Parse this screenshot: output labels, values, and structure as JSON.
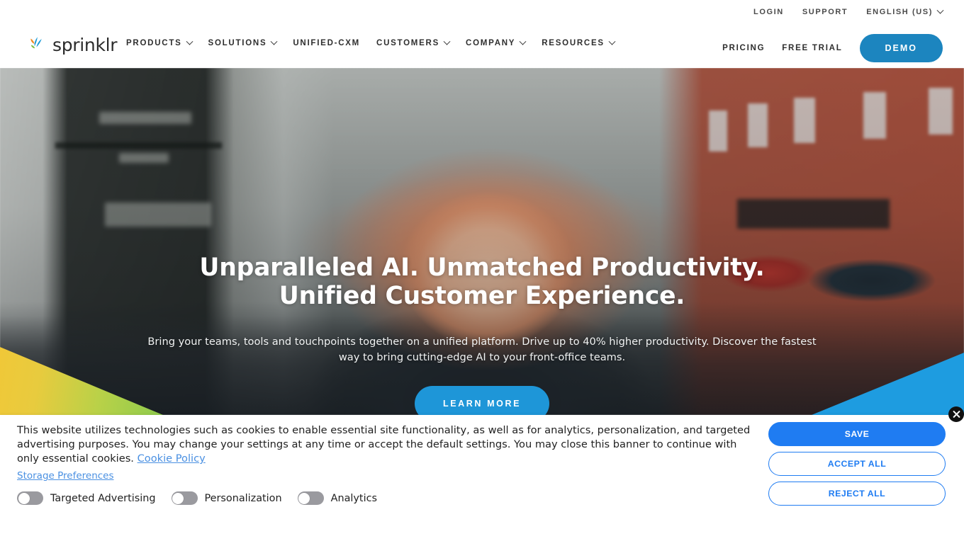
{
  "brand": {
    "name": "sprinklr",
    "logo_colors": [
      "#F08A24",
      "#1C9AD6",
      "#7DBE42"
    ]
  },
  "nav": {
    "utility": [
      {
        "label": "LOGIN"
      },
      {
        "label": "SUPPORT"
      }
    ],
    "language": {
      "label": "ENGLISH (US)",
      "icon": "chevron-down-icon"
    },
    "primary": [
      {
        "label": "PRODUCTS",
        "has_dropdown": true
      },
      {
        "label": "SOLUTIONS",
        "has_dropdown": true
      },
      {
        "label": "UNIFIED-CXM",
        "has_dropdown": false
      },
      {
        "label": "CUSTOMERS",
        "has_dropdown": true
      },
      {
        "label": "COMPANY",
        "has_dropdown": true
      },
      {
        "label": "RESOURCES",
        "has_dropdown": true
      }
    ],
    "right_links": [
      {
        "label": "PRICING"
      },
      {
        "label": "FREE TRIAL"
      }
    ],
    "demo_button": {
      "label": "DEMO",
      "color": "#1C85BF"
    }
  },
  "hero": {
    "title_line1": "Unparalleled AI. Unmatched Productivity.",
    "title_line2": "Unified Customer Experience.",
    "subtitle": "Bring your teams, tools and touchpoints together on a unified platform. Drive up to 40% higher productivity. Discover the fastest way to bring cutting-edge AI to your front-office teams.",
    "cta": {
      "label": "LEARN MORE",
      "color": "#1E96D8"
    },
    "accent_left_colors": [
      "#F0C838",
      "#8ECB4D"
    ],
    "accent_right_color": "#1E9CE0"
  },
  "cookie_banner": {
    "body_text": "This website utilizes technologies such as cookies to enable essential site functionality, as well as for analytics, personalization, and targeted advertising purposes. You may change your settings at any time or accept the default settings. You may close this banner to continue with only essential cookies. ",
    "policy_link": "Cookie Policy",
    "storage_preferences_link": "Storage Preferences",
    "toggles": [
      {
        "label": "Targeted Advertising",
        "on": false
      },
      {
        "label": "Personalization",
        "on": false
      },
      {
        "label": "Analytics",
        "on": false
      }
    ],
    "buttons": [
      {
        "label": "SAVE",
        "style": "filled",
        "color": "#1F7CF2"
      },
      {
        "label": "ACCEPT ALL",
        "style": "outline",
        "color": "#1F7CF2"
      },
      {
        "label": "REJECT ALL",
        "style": "outline",
        "color": "#1F7CF2"
      }
    ],
    "close_icon": "close-icon"
  }
}
